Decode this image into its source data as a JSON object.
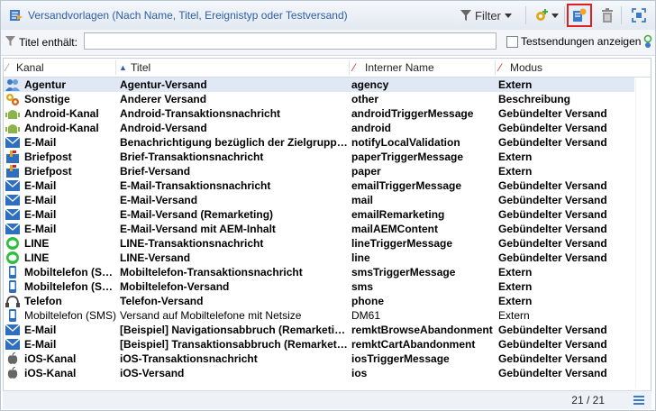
{
  "toolbar": {
    "title": "Versandvorlagen (Nach Name, Titel, Ereignistyp oder Testversand)",
    "filter_label": "Filter"
  },
  "filter": {
    "label": "Titel enthält:",
    "value": "",
    "placeholder": "",
    "test_checkbox_label": "Testsendungen anzeigen",
    "test_checked": false
  },
  "columns": {
    "kanal": "Kanal",
    "titel": "Titel",
    "interner_name": "Interner Name",
    "modus": "Modus"
  },
  "rows": [
    {
      "icon": "agency-icon",
      "kanal": "Agentur",
      "titel": "Agentur-Versand",
      "name": "agency",
      "modus": "Extern",
      "selected": true
    },
    {
      "icon": "other-icon",
      "kanal": "Sonstige",
      "titel": "Anderer Versand",
      "name": "other",
      "modus": "Beschreibung"
    },
    {
      "icon": "android-icon",
      "kanal": "Android-Kanal",
      "titel": "Android-Transaktionsnachricht",
      "name": "androidTriggerMessage",
      "modus": "Gebündelter Versand"
    },
    {
      "icon": "android-icon",
      "kanal": "Android-Kanal",
      "titel": "Android-Versand",
      "name": "android",
      "modus": "Gebündelter Versand"
    },
    {
      "icon": "email-icon",
      "kanal": "E-Mail",
      "titel": "Benachrichtigung bezüglich der Zielgruppen...",
      "name": "notifyLocalValidation",
      "modus": "Gebündelter Versand"
    },
    {
      "icon": "mail-icon",
      "kanal": "Briefpost",
      "titel": "Brief-Transaktionsnachricht",
      "name": "paperTriggerMessage",
      "modus": "Extern"
    },
    {
      "icon": "mail-icon",
      "kanal": "Briefpost",
      "titel": "Brief-Versand",
      "name": "paper",
      "modus": "Extern"
    },
    {
      "icon": "email-icon",
      "kanal": "E-Mail",
      "titel": "E-Mail-Transaktionsnachricht",
      "name": "emailTriggerMessage",
      "modus": "Gebündelter Versand"
    },
    {
      "icon": "email-icon",
      "kanal": "E-Mail",
      "titel": "E-Mail-Versand",
      "name": "mail",
      "modus": "Gebündelter Versand"
    },
    {
      "icon": "email-icon",
      "kanal": "E-Mail",
      "titel": "E-Mail-Versand (Remarketing)",
      "name": "emailRemarketing",
      "modus": "Gebündelter Versand"
    },
    {
      "icon": "email-icon",
      "kanal": "E-Mail",
      "titel": "E-Mail-Versand mit AEM-Inhalt",
      "name": "mailAEMContent",
      "modus": "Gebündelter Versand"
    },
    {
      "icon": "line-icon",
      "kanal": "LINE",
      "titel": "LINE-Transaktionsnachricht",
      "name": "lineTriggerMessage",
      "modus": "Gebündelter Versand"
    },
    {
      "icon": "line-icon",
      "kanal": "LINE",
      "titel": "LINE-Versand",
      "name": "line",
      "modus": "Gebündelter Versand"
    },
    {
      "icon": "mobile-icon",
      "kanal": "Mobiltelefon (SMS)",
      "titel": "Mobiltelefon-Transaktionsnachricht",
      "name": "smsTriggerMessage",
      "modus": "Extern"
    },
    {
      "icon": "mobile-icon",
      "kanal": "Mobiltelefon (SMS)",
      "titel": "Mobiltelefon-Versand",
      "name": "sms",
      "modus": "Extern"
    },
    {
      "icon": "phone-icon",
      "kanal": "Telefon",
      "titel": "Telefon-Versand",
      "name": "phone",
      "modus": "Extern"
    },
    {
      "icon": "mobile-icon",
      "kanal": "Mobiltelefon (SMS)",
      "titel": "Versand auf Mobiltelefone mit Netsize",
      "name": "DM61",
      "modus": "Extern",
      "normal": true
    },
    {
      "icon": "email-icon",
      "kanal": "E-Mail",
      "titel": "[Beispiel] Navigationsabbruch (Remarketing)",
      "name": "remktBrowseAbandonment",
      "modus": "Gebündelter Versand"
    },
    {
      "icon": "email-icon",
      "kanal": "E-Mail",
      "titel": "[Beispiel] Transaktionsabbruch (Remarketing)",
      "name": "remktCartAbandonment",
      "modus": "Gebündelter Versand"
    },
    {
      "icon": "apple-icon",
      "kanal": "iOS-Kanal",
      "titel": "iOS-Transaktionsnachricht",
      "name": "iosTriggerMessage",
      "modus": "Gebündelter Versand"
    },
    {
      "icon": "apple-icon",
      "kanal": "iOS-Kanal",
      "titel": "iOS-Versand",
      "name": "ios",
      "modus": "Gebündelter Versand"
    }
  ],
  "status": {
    "count": "21 / 21"
  },
  "colors": {
    "accent": "#2c5fa8",
    "highlight": "#e02020",
    "selected_row": "#dfe8f4"
  }
}
